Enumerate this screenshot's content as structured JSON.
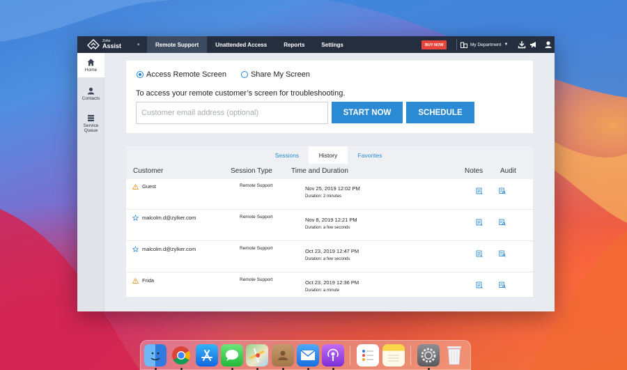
{
  "topbar": {
    "logo_small": "Zoho",
    "logo_big": "Assist",
    "tabs": [
      {
        "label": "Remote Support",
        "active": true
      },
      {
        "label": "Unattended Access",
        "active": false
      },
      {
        "label": "Reports",
        "active": false
      },
      {
        "label": "Settings",
        "active": false
      }
    ],
    "buy_now": "BUY NOW",
    "department": "My Department",
    "icons": [
      "download-icon",
      "megaphone-icon",
      "user-icon"
    ]
  },
  "sidebar": {
    "items": [
      {
        "label": "Home",
        "icon": "home-icon",
        "active": true
      },
      {
        "label": "Contacts",
        "icon": "contacts-icon",
        "active": false
      },
      {
        "label": "Service Queue",
        "icon": "queue-icon",
        "active": false
      }
    ]
  },
  "remote": {
    "option_access": "Access Remote Screen",
    "option_share": "Share My Screen",
    "selected": "Access Remote Screen",
    "description": "To access your remote customer’s screen for troubleshooting.",
    "email_placeholder": "Customer email address (optional)",
    "email_value": "",
    "start_now": "START NOW",
    "schedule": "SCHEDULE"
  },
  "history": {
    "tabs": [
      {
        "label": "Sessions",
        "active": false
      },
      {
        "label": "History",
        "active": true
      },
      {
        "label": "Favorites",
        "active": false
      }
    ],
    "columns": [
      "Customer",
      "Session Type",
      "Time and Duration",
      "Notes",
      "Audit"
    ],
    "rows": [
      {
        "customer": "Guest",
        "icon": "warning-icon",
        "session_type": "Remote Support",
        "datetime": "Nov 25, 2019 12:02 PM",
        "duration": "Duration: 2 minutes"
      },
      {
        "customer": "malcolm.d@zylker.com",
        "icon": "star-icon",
        "session_type": "Remote Support",
        "datetime": "Nov 8, 2019 12:21 PM",
        "duration": "Duration: a few seconds"
      },
      {
        "customer": "malcolm.d@zylker.com",
        "icon": "star-icon",
        "session_type": "Remote Support",
        "datetime": "Oct 23, 2019 12:47 PM",
        "duration": "Duration: a few seconds"
      },
      {
        "customer": "Frida",
        "icon": "warning-icon",
        "session_type": "Remote Support",
        "datetime": "Oct 23, 2019 12:36 PM",
        "duration": "Duration: a minute"
      }
    ]
  },
  "dock": {
    "apps": [
      "finder-icon",
      "chrome-icon",
      "app-store-icon",
      "messages-icon",
      "maps-icon",
      "contacts-app-icon",
      "mail-icon",
      "podcasts-icon",
      "reminders-icon",
      "notes-icon",
      "system-preferences-icon",
      "trash-icon"
    ]
  },
  "colors": {
    "topbar": "#252e3e",
    "accent": "#2a8ad4",
    "buy_now": "#e8453c"
  }
}
